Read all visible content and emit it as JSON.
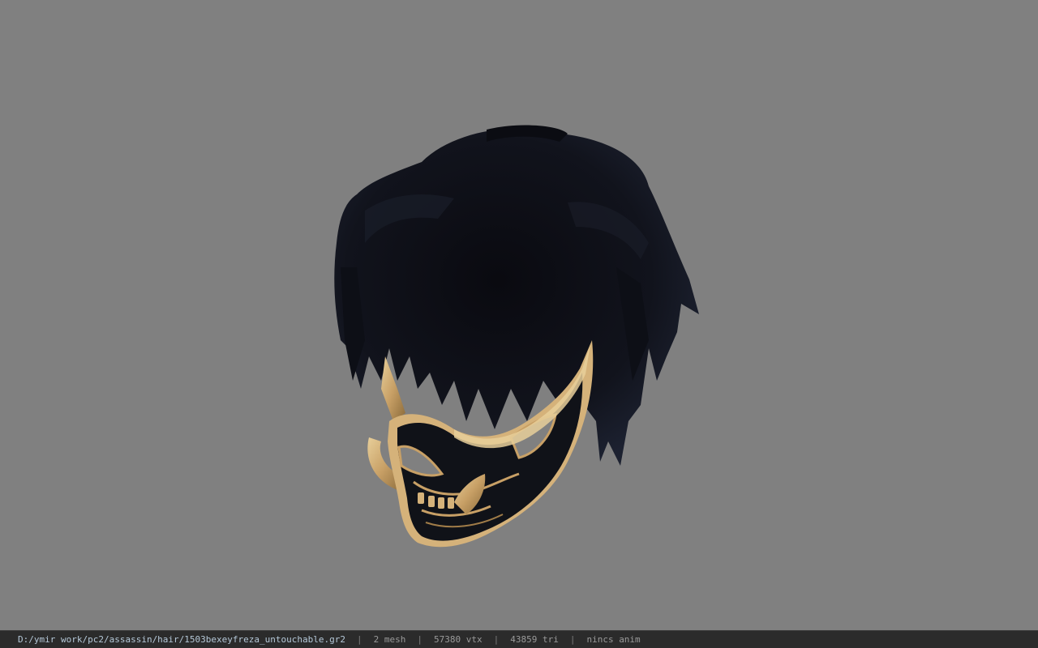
{
  "viewer": {
    "background_color": "#808080",
    "model_description_icon": "hair-mask-model-icon"
  },
  "status_bar": {
    "file_path": "D:/ymir work/pc2/assassin/hair/1503bexeyfreza_untouchable.gr2",
    "separator": "|",
    "mesh_count": "2 mesh",
    "vertex_count": "57380 vtx",
    "triangle_count": "43859 tri",
    "anim_status": "nincs anim"
  }
}
